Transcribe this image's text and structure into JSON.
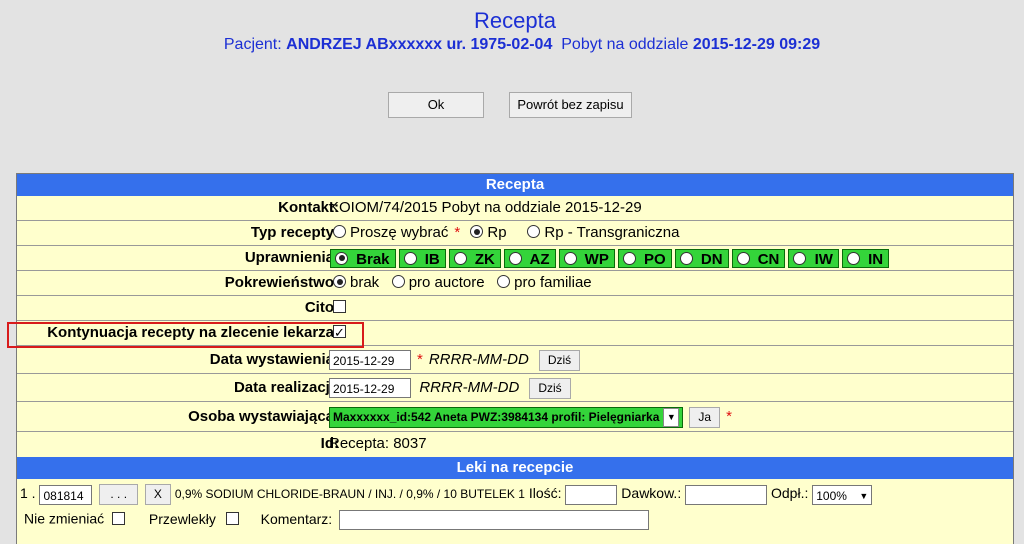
{
  "header": {
    "title": "Recepta",
    "patient_label": "Pacjent:",
    "patient_name": "ANDRZEJ ABxxxxxx ur. 1975-02-04",
    "stay_label": "Pobyt na oddziale",
    "stay_date": "2015-12-29 09:29"
  },
  "buttons": {
    "ok": "Ok",
    "back": "Powrót bez zapisu"
  },
  "form": {
    "section_title": "Recepta",
    "kontakt": {
      "label": "Kontakt:",
      "value": "KOIOM/74/2015 Pobyt na oddziale 2015-12-29"
    },
    "typ": {
      "label": "Typ recepty:",
      "options": [
        "Proszę wybrać",
        "Rp",
        "Rp - Transgraniczna"
      ],
      "selected": "Rp"
    },
    "uprawnienia": {
      "label": "Uprawnienia:",
      "options": [
        "Brak",
        "IB",
        "ZK",
        "AZ",
        "WP",
        "PO",
        "DN",
        "CN",
        "IW",
        "IN"
      ],
      "selected": "Brak"
    },
    "pokrewienstwo": {
      "label": "Pokrewieństwo:",
      "options": [
        "brak",
        "pro auctore",
        "pro familiae"
      ],
      "selected": "brak"
    },
    "cito": {
      "label": "Cito:",
      "checked": false
    },
    "kontynuacja": {
      "label": "Kontynuacja recepty na zlecenie lekarza:",
      "checked": true
    },
    "data_wyst": {
      "label": "Data wystawienia:",
      "value": "2015-12-29",
      "format": "RRRR-MM-DD",
      "btn": "Dziś"
    },
    "data_real": {
      "label": "Data realizacji:",
      "value": "2015-12-29",
      "format": "RRRR-MM-DD",
      "btn": "Dziś"
    },
    "osoba": {
      "label": "Osoba wystawiająca:",
      "value": "Maxxxxxx_id:542 Aneta PWZ:3984134 profil: Pielęgniarka",
      "btn": "Ja"
    },
    "id": {
      "label": "Id:",
      "value": "Recepta: 8037"
    }
  },
  "drugs": {
    "section_title": "Leki na recepcie",
    "item": {
      "num": "1 .",
      "code": "081814",
      "browse": ". . .",
      "remove": "X",
      "name": "0,9% SODIUM CHLORIDE-BRAUN / INJ. / 0,9% / 10 BUTELEK 1",
      "ilosc_label": "Ilość:",
      "ilosc": "",
      "dawkow_label": "Dawkow.:",
      "dawkow": "",
      "odpl_label": "Odpł.:",
      "odpl": "100%",
      "nie_zmieniac": "Nie zmieniać",
      "przewlekly": "Przewlekły",
      "komentarz": "Komentarz:"
    }
  },
  "colors": {
    "accent": "#3570ec",
    "title": "#1c2fd4",
    "chip": "#34d43a",
    "highlight": "#d81b1b"
  }
}
